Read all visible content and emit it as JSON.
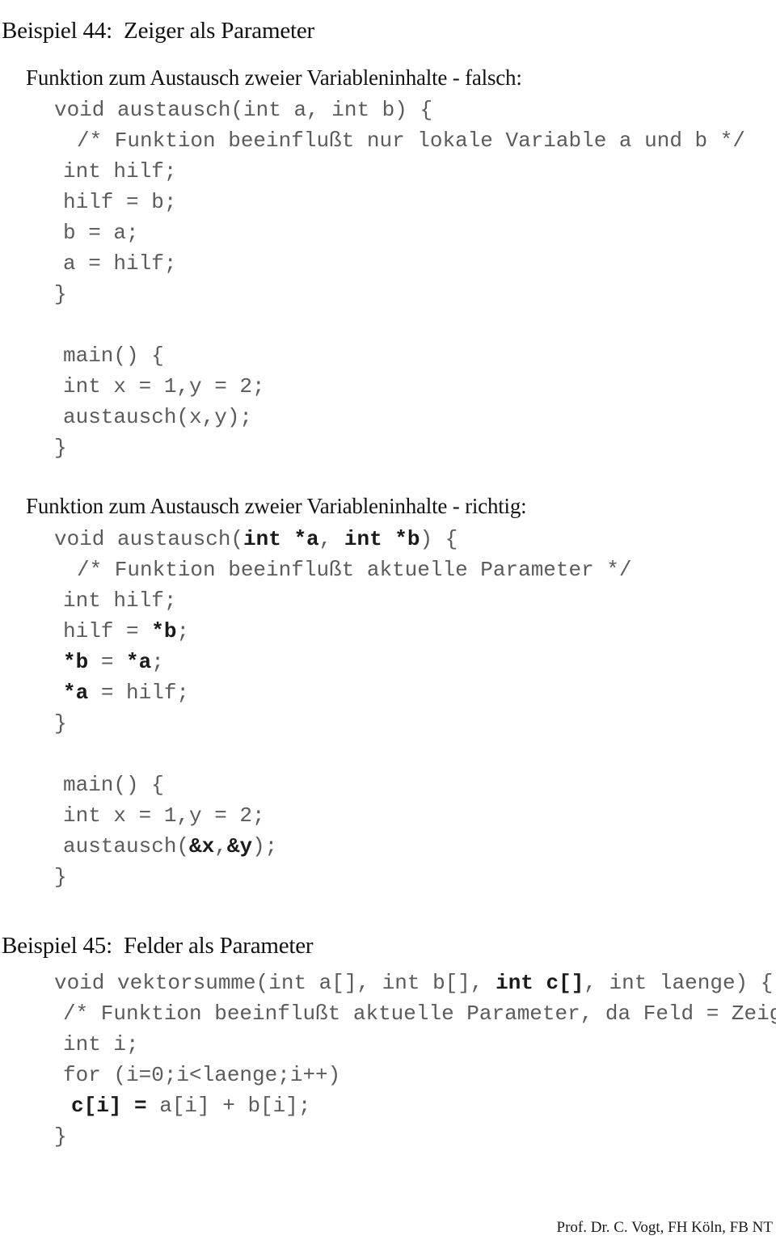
{
  "document": {
    "language": "de",
    "page_background": "#ffffff",
    "code_color": "#5b5b5b",
    "code_bold_color": "#1a1a1a",
    "heading_color": "#111111"
  },
  "example44": {
    "title": "Beispiel 44:  Zeiger als Parameter",
    "falsch_heading": "Funktion zum Austausch zweier Variableninhalte - falsch:",
    "richtig_heading": "Funktion zum Austausch zweier Variableninhalte - richtig:",
    "code_falsch": [
      {
        "indent": "ind-0",
        "parts": [
          {
            "text": "void austausch(int a, int b) {",
            "bold": false
          }
        ]
      },
      {
        "indent": "ind-2",
        "parts": [
          {
            "text": "/* Funktion beeinflußt nur lokale Variable a und b */",
            "bold": false
          }
        ]
      },
      {
        "indent": "ind-1",
        "parts": [
          {
            "text": "int hilf;",
            "bold": false
          }
        ]
      },
      {
        "indent": "ind-1",
        "parts": [
          {
            "text": "hilf = b;",
            "bold": false
          }
        ]
      },
      {
        "indent": "ind-1",
        "parts": [
          {
            "text": "b = a;",
            "bold": false
          }
        ]
      },
      {
        "indent": "ind-1",
        "parts": [
          {
            "text": "a = hilf;",
            "bold": false
          }
        ]
      },
      {
        "indent": "ind-0",
        "parts": [
          {
            "text": "}",
            "bold": false
          }
        ]
      },
      {
        "indent": "ind-0",
        "parts": [
          {
            "text": "",
            "bold": false
          }
        ]
      },
      {
        "indent": "ind-1",
        "parts": [
          {
            "text": "main() {",
            "bold": false
          }
        ]
      },
      {
        "indent": "ind-1",
        "parts": [
          {
            "text": "int x = 1,y = 2;",
            "bold": false
          }
        ]
      },
      {
        "indent": "ind-1",
        "parts": [
          {
            "text": "austausch(x,y);",
            "bold": false
          }
        ]
      },
      {
        "indent": "ind-0",
        "parts": [
          {
            "text": "}",
            "bold": false
          }
        ]
      }
    ],
    "code_richtig": [
      {
        "indent": "ind-0",
        "parts": [
          {
            "text": "void austausch(",
            "bold": false
          },
          {
            "text": "int *a",
            "bold": true
          },
          {
            "text": ", ",
            "bold": false
          },
          {
            "text": "int *b",
            "bold": true
          },
          {
            "text": ") {",
            "bold": false
          }
        ]
      },
      {
        "indent": "ind-2",
        "parts": [
          {
            "text": "/* Funktion beeinflußt aktuelle Parameter */",
            "bold": false
          }
        ]
      },
      {
        "indent": "ind-1",
        "parts": [
          {
            "text": "int hilf;",
            "bold": false
          }
        ]
      },
      {
        "indent": "ind-1",
        "parts": [
          {
            "text": "hilf = ",
            "bold": false
          },
          {
            "text": "*b",
            "bold": true
          },
          {
            "text": ";",
            "bold": false
          }
        ]
      },
      {
        "indent": "ind-1",
        "parts": [
          {
            "text": "*b",
            "bold": true
          },
          {
            "text": " = ",
            "bold": false
          },
          {
            "text": "*a",
            "bold": true
          },
          {
            "text": ";",
            "bold": false
          }
        ]
      },
      {
        "indent": "ind-1",
        "parts": [
          {
            "text": "*a",
            "bold": true
          },
          {
            "text": " = hilf;",
            "bold": false
          }
        ]
      },
      {
        "indent": "ind-0",
        "parts": [
          {
            "text": "}",
            "bold": false
          }
        ]
      },
      {
        "indent": "ind-0",
        "parts": [
          {
            "text": "",
            "bold": false
          }
        ]
      },
      {
        "indent": "ind-1",
        "parts": [
          {
            "text": "main() {",
            "bold": false
          }
        ]
      },
      {
        "indent": "ind-1",
        "parts": [
          {
            "text": "int x = 1,y = 2;",
            "bold": false
          }
        ]
      },
      {
        "indent": "ind-1",
        "parts": [
          {
            "text": "austausch(",
            "bold": false
          },
          {
            "text": "&x",
            "bold": true
          },
          {
            "text": ",",
            "bold": false
          },
          {
            "text": "&y",
            "bold": true
          },
          {
            "text": ");",
            "bold": false
          }
        ]
      },
      {
        "indent": "ind-0",
        "parts": [
          {
            "text": "}",
            "bold": false
          }
        ]
      }
    ]
  },
  "example45": {
    "title": "Beispiel 45:  Felder als Parameter",
    "code": [
      {
        "indent": "ind-0",
        "parts": [
          {
            "text": "void vektorsumme(int a[], int b[], ",
            "bold": false
          },
          {
            "text": "int c[]",
            "bold": true
          },
          {
            "text": ", int laenge) {",
            "bold": false
          }
        ]
      },
      {
        "indent": "ind-1",
        "parts": [
          {
            "text": "/* Funktion beeinflußt aktuelle Parameter, da Feld = Zeiger */",
            "bold": false
          }
        ]
      },
      {
        "indent": "ind-1",
        "parts": [
          {
            "text": "int i;",
            "bold": false
          }
        ]
      },
      {
        "indent": "ind-1",
        "parts": [
          {
            "text": "for (i=0;i<laenge;i++)",
            "bold": false
          }
        ]
      },
      {
        "indent": "ind-3",
        "parts": [
          {
            "text": "c[i] =",
            "bold": true
          },
          {
            "text": " a[i] + b[i];",
            "bold": false
          }
        ]
      },
      {
        "indent": "ind-0",
        "parts": [
          {
            "text": "}",
            "bold": false
          }
        ]
      }
    ]
  },
  "footer": {
    "text": "Prof. Dr. C. Vogt, FH Köln, FB NT"
  }
}
